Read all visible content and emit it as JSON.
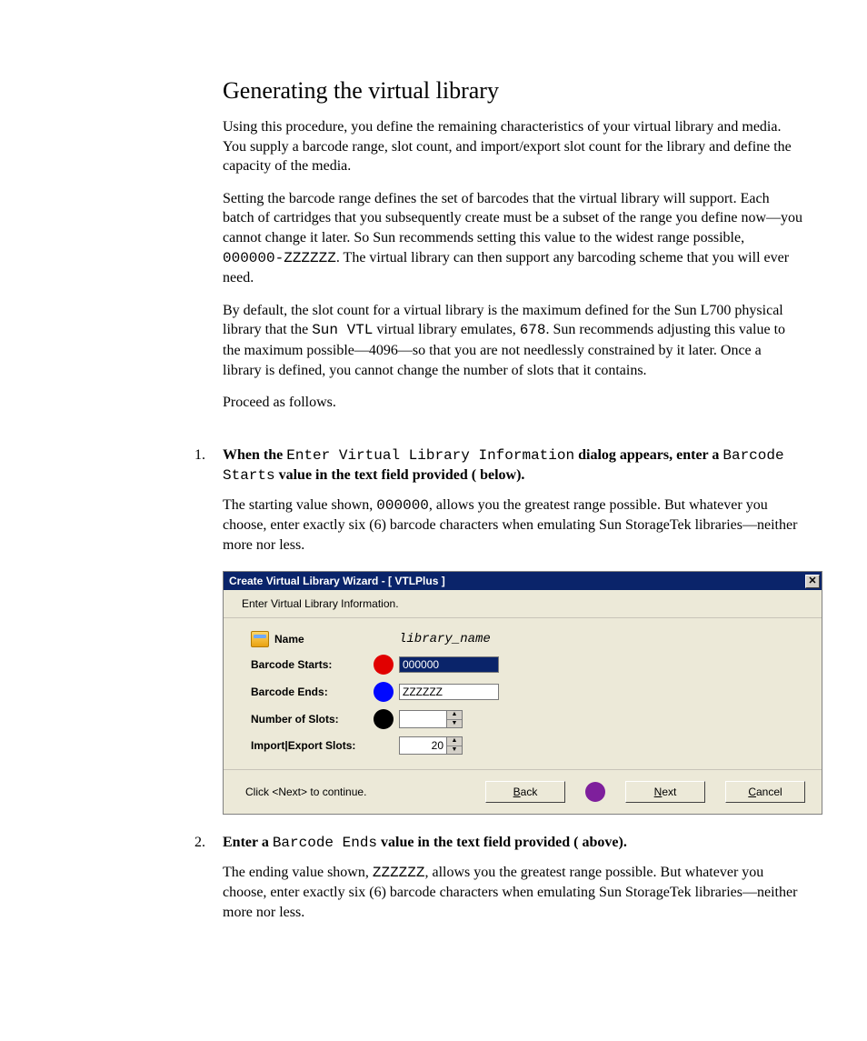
{
  "heading": "Generating the virtual library",
  "para1_a": "Using this procedure, you define the remaining characteristics of your virtual library and media. You supply a barcode range, slot count, and import/export slot count for the library and define the capacity of the media.",
  "para2_a": "Setting the barcode range defines the set of barcodes that the virtual library will support. Each batch of cartridges that you subsequently create must be a subset of the range you define now—you cannot change it later. So Sun recommends setting this value to the widest range possible, ",
  "para2_code": "000000-ZZZZZZ",
  "para2_b": ". The virtual library can then support any barcoding scheme that you will ever need.",
  "para3_a": "By default, the slot count for a virtual library is the maximum defined for the Sun L700 physical library that the ",
  "para3_code1": "Sun VTL",
  "para3_b": " virtual library emulates, ",
  "para3_code2": "678",
  "para3_c": ". Sun recommends adjusting this value to the maximum possible—4096—so that you are not needlessly constrained by it later. Once a library is defined, you cannot change the number of slots that it contains.",
  "para4": "Proceed as follows.",
  "step1": {
    "lead_a": "When the ",
    "code1": "Enter Virtual Library Information",
    "lead_b": " dialog appears, enter a ",
    "code2": "Barcode Starts",
    "lead_c": " value in the text field provided (   below).",
    "body_a": "The starting value shown, ",
    "body_code": "000000",
    "body_b": ", allows you the greatest range possible. But whatever you choose, enter exactly six (6) barcode characters when emulating Sun StorageTek libraries—neither more nor less."
  },
  "dialog": {
    "title": "Create Virtual Library Wizard - [ VTLPlus ]",
    "close_glyph": "✕",
    "subhead": "Enter Virtual Library Information.",
    "name_label": "Name",
    "name_value": "library_name",
    "barcode_starts_label": "Barcode Starts:",
    "barcode_starts_value": "000000",
    "barcode_ends_label": "Barcode Ends:",
    "barcode_ends_value": "ZZZZZZ",
    "num_slots_label": "Number of Slots:",
    "num_slots_value": "",
    "import_export_label": "Import|Export Slots:",
    "import_export_value": "20",
    "hint": "Click <Next> to continue.",
    "back_u": "B",
    "back_rest": "ack",
    "next_u": "N",
    "next_rest": "ext",
    "cancel_u": "C",
    "cancel_rest": "ancel",
    "up_glyph": "▲",
    "down_glyph": "▼"
  },
  "step2": {
    "lead_a": "Enter a ",
    "code1": "Barcode Ends",
    "lead_b": " value in the text field provided (   above).",
    "body_a": "The ending value shown, ",
    "body_code": "ZZZZZZ",
    "body_b": ", allows you the greatest range possible. But whatever you choose, enter exactly six (6) barcode characters when emulating Sun StorageTek libraries—neither more nor less."
  }
}
